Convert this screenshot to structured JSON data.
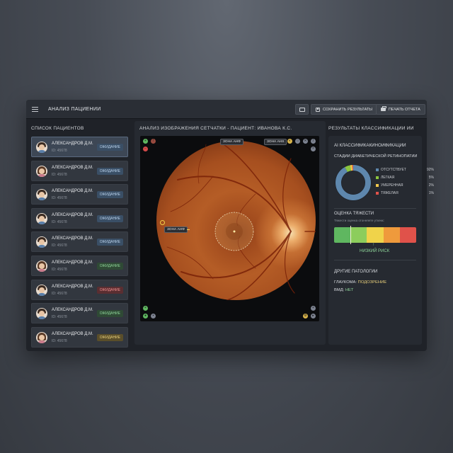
{
  "header": {
    "title": "АНАЛИЗ ПАЦИЕНИИ",
    "save_label": "СОХРАНИТЬ РЕЗУЛЬТАТЫ",
    "print_label": "ПЕЧАТЬ ОТЧЕТА",
    "folder_icon": "folder-icon",
    "save_icon": "save-icon",
    "print_icon": "printer-icon"
  },
  "sidebar": {
    "title": "СПИСОК ПАЦИЕНТОВ",
    "patients": [
      {
        "name": "АЛЕКСАНДРОВ Д.М.",
        "id": "ID: 45678",
        "status": "ОЖИДАНИЕ",
        "status_color": "#b9d2ec",
        "avatar": "male"
      },
      {
        "name": "АЛЕКСАНДРОВ Д.М.",
        "id": "ID: 45678",
        "status": "ОЖИДАНИЕ",
        "status_color": "#b9d2ec",
        "avatar": "female"
      },
      {
        "name": "АЛЕКСАНДРОВ Д.М.",
        "id": "ID: 45678",
        "status": "ОЖИДАНИЕ",
        "status_color": "#b9d2ec",
        "avatar": "male"
      },
      {
        "name": "АЛЕКСАНДРОВ Д.М.",
        "id": "ID: 45678",
        "status": "ОЖИДАНИЕ",
        "status_color": "#b9d2ec",
        "avatar": "male"
      },
      {
        "name": "АЛЕКСАНДРОВ Д.М.",
        "id": "ID: 45678",
        "status": "ОЖИДАНИЕ",
        "status_color": "#b9d2ec",
        "avatar": "male"
      },
      {
        "name": "АЛЕКСАНДРОВ Д.М.",
        "id": "ID: 45678",
        "status": "ОЖИДАНИЕ",
        "status_color": "#8fd69a",
        "avatar": "female"
      },
      {
        "name": "АЛЕКСАНДРОВ Д.М.",
        "id": "ID: 45678",
        "status": "ОЖИДАНИЕ",
        "status_color": "#f08f8f",
        "avatar": "male"
      },
      {
        "name": "АЛЕКСАНДРОВ Д.М.",
        "id": "ID: 45678",
        "status": "ОЖИДАНИЕ",
        "status_color": "#8fd69a",
        "avatar": "male"
      },
      {
        "name": "АЛЕКСАНДРОВ Д.М.",
        "id": "ID: 45678",
        "status": "ОЖИДАНИЕ",
        "status_color": "#e8cf7a",
        "avatar": "female"
      }
    ]
  },
  "viewer": {
    "title": "АНАЛИЗ ИЗОБРАЖЕНИЯ СЕТЧАТКИ - ПАЦИЕНТ: ИВАНОВА К.С.",
    "zone_top": "ЗОНА АНФ",
    "zone_right": "ЗОНА АНЅ",
    "zone_left": "ЗОНА АНФ"
  },
  "results": {
    "title": "РЕЗУЛЬТАТЫ КЛАССИФИКАЦИИ ИИ",
    "ai_title": "AI КЛАССИФИКАКИНОИФИКАЦИИ",
    "stages_title": "СТАДИИ ДИАБЕТИЧЕСКОЙ РЕТИНОПАТИИ",
    "stages": [
      {
        "label": "ОТСУТСТВУЕТ",
        "percent": "92%",
        "value": 92,
        "color": "#5e87ad"
      },
      {
        "label": "ЛЕГКАЯ",
        "percent": "5%",
        "value": 5,
        "color": "#8cc63f"
      },
      {
        "label": "УМЕРЕННАЯ",
        "percent": "2%",
        "value": 2,
        "color": "#f2c94c"
      },
      {
        "label": "ТЯЖЕЛАЯ",
        "percent": "1%",
        "value": 1,
        "color": "#e0524a"
      }
    ],
    "severity_title": "ОЦЕНКА ТЯЖЕСТИ",
    "severity_subtitle": "Тяжести оценка отонняете уткекк:",
    "severity_colors": [
      "#5fb760",
      "#8ccd5c",
      "#f0d34a",
      "#ef9a3c",
      "#e0524a"
    ],
    "severity_level": 0.2,
    "risk_label": "НИЗКИЙ РИСК",
    "other_title": "ДРУГИЕ ПАТОЛОГИИ",
    "glaucoma_label": "ГЛАУКОМА:",
    "glaucoma_value": "ПОДОЗРЕНИЕ",
    "glaucoma_color": "#e8cf7a",
    "amd_label": "ВМД:",
    "amd_value": "НЕТ",
    "amd_color": "#8fd69a"
  }
}
